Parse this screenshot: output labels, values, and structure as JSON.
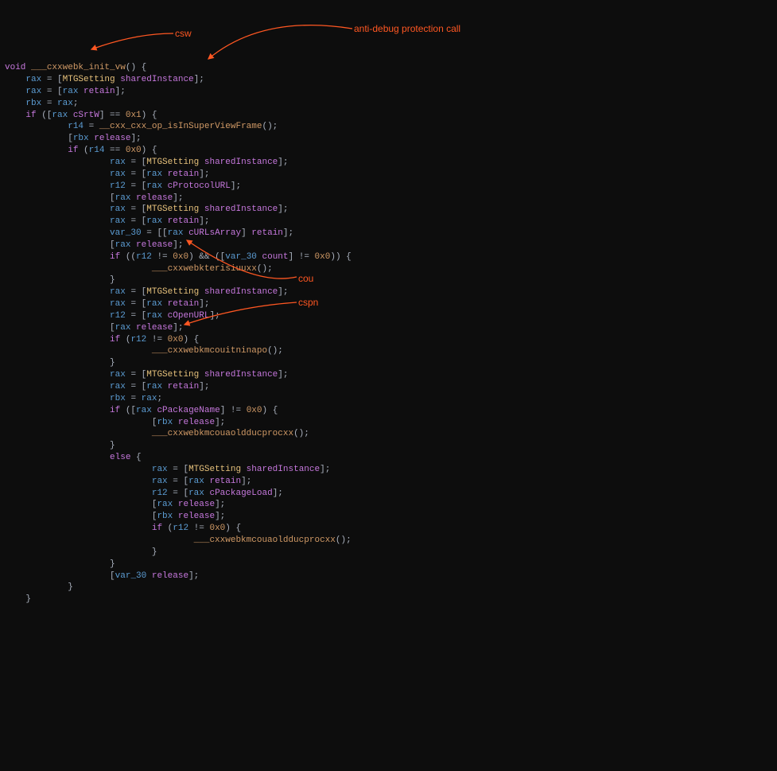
{
  "annotations": {
    "csw": "csw",
    "antidebug": "anti-debug protection call",
    "cou": "cou",
    "cspn": "cspn"
  },
  "code": {
    "l1_void": "void",
    "l1_fn": "___cxxwebk_init_vw",
    "l1_rest": "() {",
    "l2_rax": "rax",
    "l2_eq": " = [",
    "l2_cls": "MTGSetting",
    "l2_msg": " sharedInstance",
    "l2_e": "];",
    "l3_rax": "rax",
    "l3_eq": " = [",
    "l3_rax2": "rax",
    "l3_msg": " retain",
    "l3_e": "];",
    "l4_rbx": "rbx",
    "l4_eq": " = ",
    "l4_rax": "rax",
    "l4_e": ";",
    "l5_if": "if",
    "l5_a": " ([",
    "l5_rax": "rax",
    "l5_msg": " cSrtW",
    "l5_b": "] == ",
    "l5_n": "0x1",
    "l5_c": ") {",
    "l6_r14": "r14",
    "l6_eq": " = ",
    "l6_fn": "__cxx_cxx_op_isInSuperViewFrame",
    "l6_e": "();",
    "l7_a": "[",
    "l7_rbx": "rbx",
    "l7_msg": " release",
    "l7_e": "];",
    "l8_if": "if",
    "l8_a": " (",
    "l8_r14": "r14",
    "l8_b": " == ",
    "l8_n": "0x0",
    "l8_c": ") {",
    "l9_r": "rax",
    "l9_eq": " = [",
    "l9_c": "MTGSetting",
    "l9_m": " sharedInstance",
    "l9_e": "];",
    "l10_r": "rax",
    "l10_eq": " = [",
    "l10_r2": "rax",
    "l10_m": " retain",
    "l10_e": "];",
    "l11_r": "r12",
    "l11_eq": " = [",
    "l11_r2": "rax",
    "l11_m": " cProtocolURL",
    "l11_e": "];",
    "l12_a": "[",
    "l12_r": "rax",
    "l12_m": " release",
    "l12_e": "];",
    "l13_r": "rax",
    "l13_eq": " = [",
    "l13_c": "MTGSetting",
    "l13_m": " sharedInstance",
    "l13_e": "];",
    "l14_r": "rax",
    "l14_eq": " = [",
    "l14_r2": "rax",
    "l14_m": " retain",
    "l14_e": "];",
    "l15_v": "var_30",
    "l15_eq": " = [[",
    "l15_r": "rax",
    "l15_m1": " cURLsArray",
    "l15_b": "] ",
    "l15_m2": "retain",
    "l15_e": "];",
    "l16_a": "[",
    "l16_r": "rax",
    "l16_m": " release",
    "l16_e": "];",
    "l17_if": "if",
    "l17_a": " ((",
    "l17_r": "r12",
    "l17_b": " != ",
    "l17_n1": "0x0",
    "l17_c": ") && ([",
    "l17_v": "var_30",
    "l17_m": " count",
    "l17_d": "] != ",
    "l17_n2": "0x0",
    "l17_e": ")) {",
    "l18_fn": "___cxxwebkterisiuuxx",
    "l18_e": "();",
    "l19_b": "}",
    "l20_r": "rax",
    "l20_eq": " = [",
    "l20_c": "MTGSetting",
    "l20_m": " sharedInstance",
    "l20_e": "];",
    "l21_r": "rax",
    "l21_eq": " = [",
    "l21_r2": "rax",
    "l21_m": " retain",
    "l21_e": "];",
    "l22_r": "r12",
    "l22_eq": " = [",
    "l22_r2": "rax",
    "l22_m": " cOpenURL",
    "l22_e": "];",
    "l23_a": "[",
    "l23_r": "rax",
    "l23_m": " release",
    "l23_e": "];",
    "l24_if": "if",
    "l24_a": " (",
    "l24_r": "r12",
    "l24_b": " != ",
    "l24_n": "0x0",
    "l24_c": ") {",
    "l25_fn": "___cxxwebkmcouitninapo",
    "l25_e": "();",
    "l26_b": "}",
    "l27_r": "rax",
    "l27_eq": " = [",
    "l27_c": "MTGSetting",
    "l27_m": " sharedInstance",
    "l27_e": "];",
    "l28_r": "rax",
    "l28_eq": " = [",
    "l28_r2": "rax",
    "l28_m": " retain",
    "l28_e": "];",
    "l29_r": "rbx",
    "l29_eq": " = ",
    "l29_r2": "rax",
    "l29_e": ";",
    "l30_if": "if",
    "l30_a": " ([",
    "l30_r": "rax",
    "l30_m": " cPackageName",
    "l30_b": "] != ",
    "l30_n": "0x0",
    "l30_c": ") {",
    "l31_a": "[",
    "l31_r": "rbx",
    "l31_m": " release",
    "l31_e": "];",
    "l32_fn": "___cxxwebkmcouaoldducprocxx",
    "l32_e": "();",
    "l33_b": "}",
    "l34_else": "else",
    "l34_b": " {",
    "l35_r": "rax",
    "l35_eq": " = [",
    "l35_c": "MTGSetting",
    "l35_m": " sharedInstance",
    "l35_e": "];",
    "l36_r": "rax",
    "l36_eq": " = [",
    "l36_r2": "rax",
    "l36_m": " retain",
    "l36_e": "];",
    "l37_r": "r12",
    "l37_eq": " = [",
    "l37_r2": "rax",
    "l37_m": " cPackageLoad",
    "l37_e": "];",
    "l38_a": "[",
    "l38_r": "rax",
    "l38_m": " release",
    "l38_e": "];",
    "l39_a": "[",
    "l39_r": "rbx",
    "l39_m": " release",
    "l39_e": "];",
    "l40_if": "if",
    "l40_a": " (",
    "l40_r": "r12",
    "l40_b": " != ",
    "l40_n": "0x0",
    "l40_c": ") {",
    "l41_fn": "___cxxwebkmcouaoldducprocxx",
    "l41_e": "();",
    "l42_b": "}",
    "l43_b": "}",
    "l44_a": "[",
    "l44_v": "var_30",
    "l44_m": " release",
    "l44_e": "];",
    "l45_b": "}",
    "l46_b": "}"
  }
}
